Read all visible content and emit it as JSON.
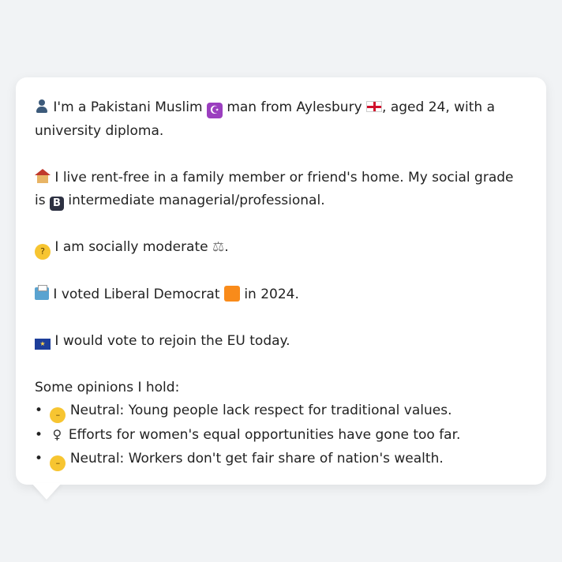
{
  "profile": {
    "line1_a": "I'm a Pakistani Muslim",
    "line1_b": "man from Aylesbury",
    "line1_c": ", aged 24, with a university diploma.",
    "line2_a": "I live rent-free in a family member or friend's home. My social grade is",
    "line2_b": "intermediate managerial/professional.",
    "line3_a": "I am socially moderate",
    "line3_b": ".",
    "line4_a": "I voted Liberal Democrat",
    "line4_b": "in 2024.",
    "line5": "I would vote to rejoin the EU today.",
    "opinions_heading": "Some opinions I hold:",
    "opinions": [
      {
        "text": "Neutral: Young people lack respect for traditional values.",
        "icon": "neutral-face-icon"
      },
      {
        "text": "Efforts for women's equal opportunities have gone too far.",
        "icon": "female-sign-icon"
      },
      {
        "text": "Neutral: Workers don't get fair share of nation's wealth.",
        "icon": "neutral-face-icon"
      }
    ],
    "bullet": "•",
    "badge_letter": "B"
  },
  "colors": {
    "background": "#f1f3f5",
    "card": "#ffffff",
    "text": "#222222",
    "lib_dem": "#f98b1a"
  }
}
